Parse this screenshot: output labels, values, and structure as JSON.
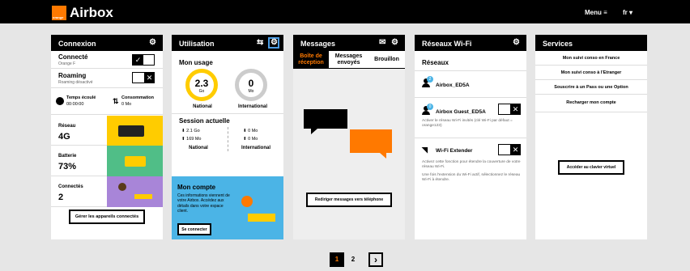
{
  "header": {
    "logo_text": "orange",
    "app_title": "Airbox",
    "menu_label": "Menu ≡",
    "lang_label": "fr ▾"
  },
  "connexion": {
    "title": "Connexion",
    "connected_label": "Connecté",
    "operator": "Orange F",
    "roaming_label": "Roaming",
    "roaming_status": "Roaming désactivé",
    "elapsed_label": "Temps écoulé",
    "elapsed_value": "00:00:00",
    "consumption_label": "Consommation",
    "consumption_value": "0 Mo",
    "network_label": "Réseau",
    "network_value": "4G",
    "battery_label": "Batterie",
    "battery_value": "73%",
    "connected_devices_label": "Connectés",
    "connected_devices_value": "2",
    "manage_button": "Gérer les appareils connectés"
  },
  "utilisation": {
    "title": "Utilisation",
    "usage_label": "Mon usage",
    "national_value": "2.3",
    "national_unit": "Go",
    "national_label": "National",
    "international_value": "0",
    "international_unit": "Mo",
    "international_label": "International",
    "session_label": "Session actuelle",
    "nat_down": "2.1 Go",
    "nat_up": "169 Mo",
    "int_down": "0 Mo",
    "int_up": "0 Mo",
    "session_nat": "National",
    "session_int": "International",
    "account_title": "Mon compte",
    "account_text": "Ces informations viennent de votre Airbox. Accédez aux détails dans votre espace client.",
    "connect_button": "Se connecter"
  },
  "messages": {
    "title": "Messages",
    "tabs": [
      "Boîte de réception",
      "Messages envoyés",
      "Brouillon"
    ],
    "redirect_button": "Rediriger messages vers téléphone"
  },
  "wifi": {
    "title": "Réseaux Wi-Fi",
    "networks_label": "Réseaux",
    "net1_name": "Airbox_ED5A",
    "net1_count": "2",
    "net2_name": "Airbox Guest_ED5A",
    "net2_count": "0",
    "net2_desc": "Activer le réseau Wi-Fi invités (clé Wi-Fi par défaut = orange123)",
    "extender_label": "Wi-Fi Extender",
    "extender_desc1": "Activez cette fonction pour étendre la couverture de votre réseau Wi-Fi.",
    "extender_desc2": "Une fois l'extension du Wi-Fi actif, sélectionnez le réseau Wi-Fi à étendre."
  },
  "services": {
    "title": "Services",
    "links": [
      "Mon suivi conso en France",
      "Mon suivi conso à l'Etranger",
      "Souscrire à un Pass ou une Option",
      "Recharger mon compte"
    ],
    "keyboard_button": "Accéder au clavier virtuel"
  },
  "pagination": {
    "page1": "1",
    "page2": "2",
    "next": "›"
  }
}
